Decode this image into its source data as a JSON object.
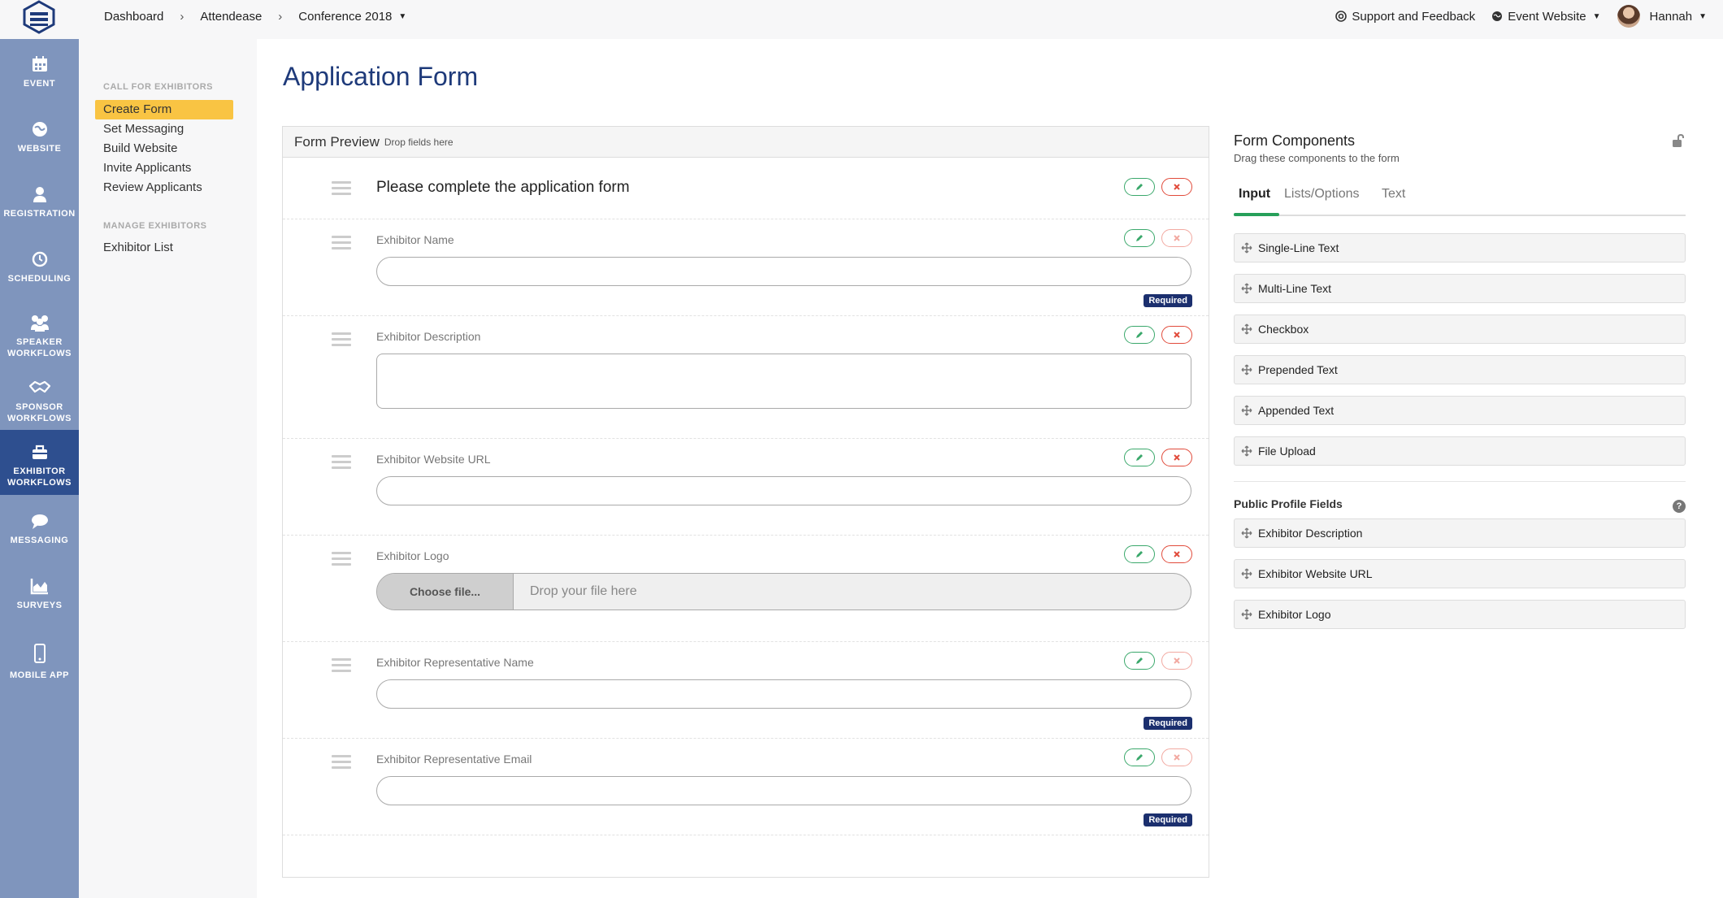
{
  "breadcrumb": [
    "Dashboard",
    "Attendease",
    "Conference 2018"
  ],
  "topbar": {
    "support": "Support and Feedback",
    "event_website": "Event Website",
    "user": "Hannah"
  },
  "leftnav": [
    {
      "label": "EVENT",
      "icon": "calendar-icon"
    },
    {
      "label": "WEBSITE",
      "icon": "globe-icon"
    },
    {
      "label": "REGISTRATION",
      "icon": "person-icon"
    },
    {
      "label": "SCHEDULING",
      "icon": "clock-icon"
    },
    {
      "label": "SPEAKER",
      "label2": "WORKFLOWS",
      "icon": "group-icon"
    },
    {
      "label": "SPONSOR",
      "label2": "WORKFLOWS",
      "icon": "handshake-icon"
    },
    {
      "label": "EXHIBITOR",
      "label2": "WORKFLOWS",
      "icon": "briefcase-icon",
      "active": true
    },
    {
      "label": "MESSAGING",
      "icon": "chat-icon"
    },
    {
      "label": "SURVEYS",
      "icon": "area-chart-icon"
    },
    {
      "label": "MOBILE APP",
      "icon": "phone-icon"
    }
  ],
  "subnav": {
    "group1": "CALL FOR EXHIBITORS",
    "group1_links": [
      "Create Form",
      "Set Messaging",
      "Build Website",
      "Invite Applicants",
      "Review Applicants"
    ],
    "group2": "MANAGE EXHIBITORS",
    "group2_links": [
      "Exhibitor List"
    ]
  },
  "page_title": "Application Form",
  "preview": {
    "title": "Form Preview",
    "subtitle": "Drop fields here",
    "heading": "Please complete the application form",
    "fields": [
      {
        "label": "Exhibitor Name",
        "required": "Required"
      },
      {
        "label": "Exhibitor Description"
      },
      {
        "label": "Exhibitor Website URL"
      },
      {
        "label": "Exhibitor Logo",
        "choose": "Choose file...",
        "drop": "Drop your file here"
      },
      {
        "label": "Exhibitor Representative Name",
        "required": "Required"
      },
      {
        "label": "Exhibitor Representative Email",
        "required": "Required"
      }
    ]
  },
  "components": {
    "title": "Form Components",
    "subtitle": "Drag these components to the form",
    "tabs": [
      "Input",
      "Lists/Options",
      "Text"
    ],
    "items": [
      "Single-Line Text",
      "Multi-Line Text",
      "Checkbox",
      "Prepended Text",
      "Appended Text",
      "File Upload"
    ],
    "public_title": "Public Profile Fields",
    "help": "?",
    "public_items": [
      "Exhibitor Description",
      "Exhibitor Website URL",
      "Exhibitor Logo"
    ]
  },
  "colors": {
    "nav": "#7f95bd",
    "nav_active": "#2e4f8f",
    "accent": "#f9c443",
    "title": "#1e3a7a",
    "tab_active": "#27a05a",
    "required_badge": "#1b2f6e",
    "edit": "#3aa86b",
    "delete": "#e14b3b"
  }
}
